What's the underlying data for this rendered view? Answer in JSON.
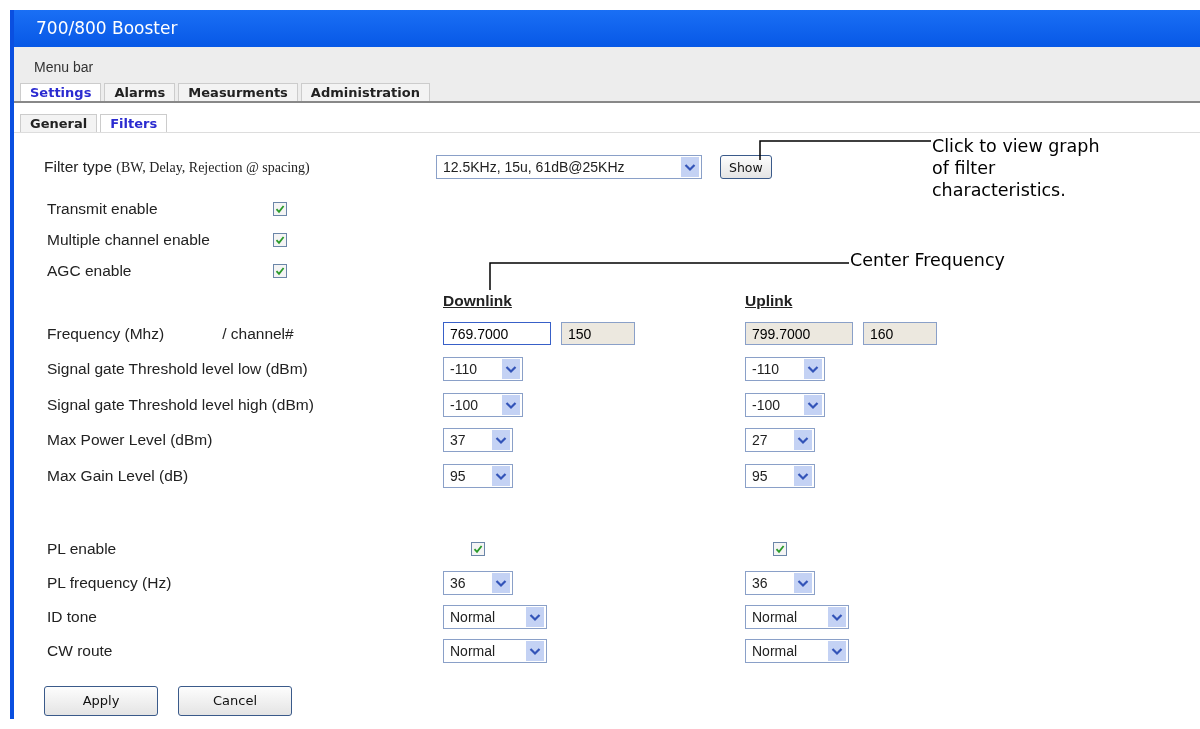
{
  "window": {
    "title": "700/800 Booster"
  },
  "menu_bar": "Menu bar",
  "tabs": [
    {
      "label": "Settings",
      "selected": true
    },
    {
      "label": "Alarms",
      "selected": false
    },
    {
      "label": "Measurments",
      "selected": false
    },
    {
      "label": "Administration",
      "selected": false
    }
  ],
  "subtabs": [
    {
      "label": "General",
      "selected": false
    },
    {
      "label": "Filters",
      "selected": true
    }
  ],
  "filter_type": {
    "label": "Filter type",
    "hint": "(BW, Delay, Rejection @ spacing)",
    "value": "12.5KHz, 15u, 61dB@25KHz",
    "button": "Show"
  },
  "checks": [
    {
      "label": "Transmit enable",
      "checked": true
    },
    {
      "label": "Multiple channel enable",
      "checked": true
    },
    {
      "label": "AGC enable",
      "checked": true
    }
  ],
  "columns": [
    "Downlink",
    "Uplink"
  ],
  "frequency": {
    "label": "Frequency  (Mhz)",
    "channel_label": "/ channel#",
    "downlink": {
      "value": "769.7000",
      "disabled": false,
      "channel": "150"
    },
    "uplink": {
      "value": "799.7000",
      "disabled": true,
      "channel": "160"
    }
  },
  "rows": [
    {
      "kind": "select",
      "label": "Signal gate Threshold level low (dBm)",
      "downlink": "-110",
      "uplink": "-110"
    },
    {
      "kind": "select",
      "label": "Signal gate Threshold level high (dBm)",
      "downlink": "-100",
      "uplink": "-100"
    },
    {
      "kind": "select",
      "label": "Max Power Level (dBm)",
      "downlink": "37",
      "uplink": "27"
    },
    {
      "kind": "select",
      "label": "Max Gain Level (dB)",
      "downlink": "95",
      "uplink": "95"
    }
  ],
  "pl_rows": [
    {
      "kind": "checkbox",
      "label": "PL enable",
      "downlink": true,
      "uplink": true
    },
    {
      "kind": "select",
      "label": "PL frequency (Hz)",
      "downlink": "36",
      "uplink": "36"
    },
    {
      "kind": "select",
      "label": "ID tone",
      "downlink": "Normal",
      "uplink": "Normal"
    },
    {
      "kind": "select",
      "label": "CW route",
      "downlink": "Normal",
      "uplink": "Normal"
    }
  ],
  "annotations": [
    {
      "text": "Click to view graph of filter characteristics."
    },
    {
      "text": "Center Frequency"
    }
  ],
  "buttons": [
    "Apply",
    "Cancel"
  ]
}
